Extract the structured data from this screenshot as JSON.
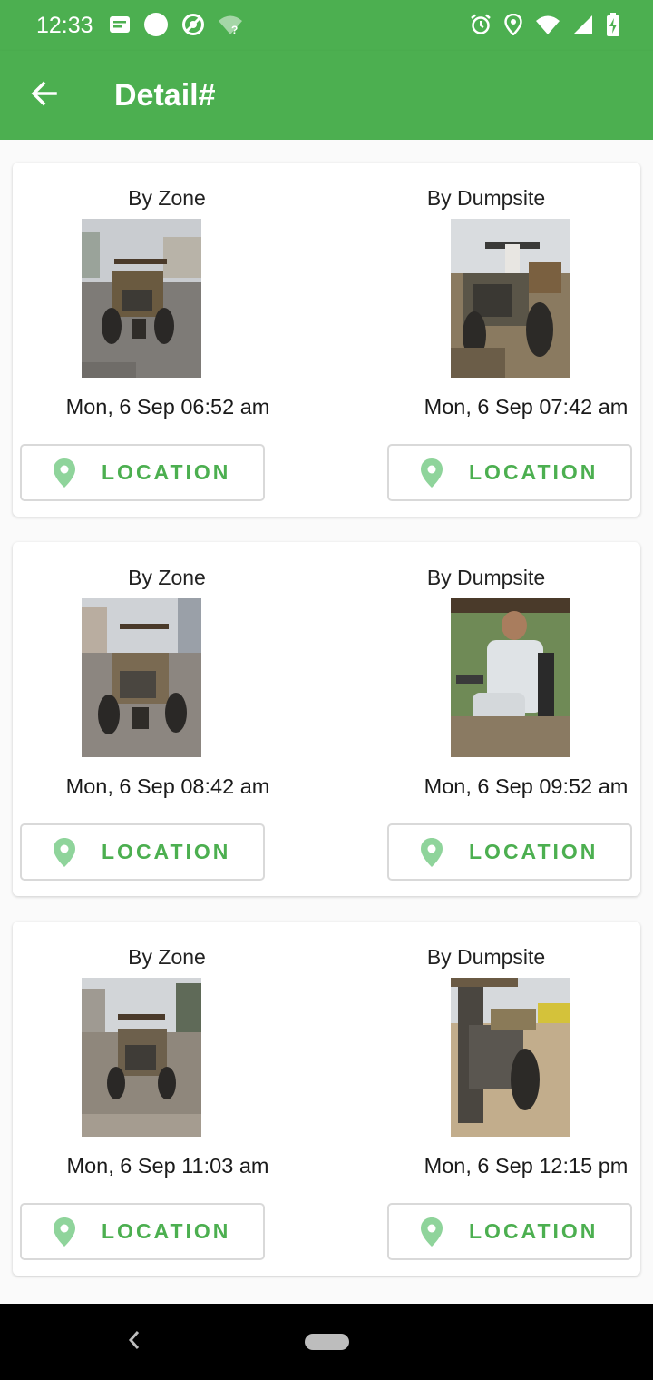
{
  "status_bar": {
    "time": "12:33",
    "left_icons": [
      "notification-icon",
      "circle-icon",
      "sync-icon",
      "wifi-question-icon"
    ],
    "right_icons": [
      "alarm-icon",
      "location-icon",
      "wifi-icon",
      "signal-icon",
      "battery-charging-icon"
    ]
  },
  "app_bar": {
    "back_icon": "arrow-back-icon",
    "title": "Detail#"
  },
  "colors": {
    "primary": "#4caf50",
    "pin": "#8fd49b",
    "nav_bar": "#000000"
  },
  "records": [
    {
      "zone": {
        "label": "By Zone",
        "time": "Mon, 6 Sep 06:52 am",
        "button_label": "LOCATION"
      },
      "dumpsite": {
        "label": "By Dumpsite",
        "time": "Mon, 6 Sep 07:42 am",
        "button_label": "LOCATION"
      }
    },
    {
      "zone": {
        "label": "By Zone",
        "time": "Mon, 6 Sep 08:42 am",
        "button_label": "LOCATION"
      },
      "dumpsite": {
        "label": "By Dumpsite",
        "time": "Mon, 6 Sep 09:52 am",
        "button_label": "LOCATION"
      }
    },
    {
      "zone": {
        "label": "By Zone",
        "time": "Mon, 6 Sep 11:03 am",
        "button_label": "LOCATION"
      },
      "dumpsite": {
        "label": "By Dumpsite",
        "time": "Mon, 6 Sep 12:15 pm",
        "button_label": "LOCATION"
      }
    }
  ]
}
